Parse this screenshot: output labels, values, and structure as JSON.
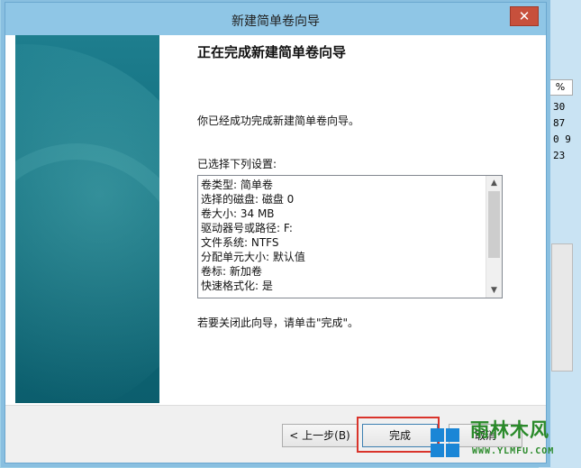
{
  "background_window": {
    "column_header": "%",
    "cells": [
      "30",
      "87",
      "0 9",
      "23"
    ]
  },
  "dialog": {
    "title": "新建简单卷向导",
    "close_glyph": "✕",
    "heading": "正在完成新建简单卷向导",
    "intro": "你已经成功完成新建简单卷向导。",
    "settings_label": "已选择下列设置:",
    "settings": [
      "卷类型: 简单卷",
      "选择的磁盘: 磁盘 0",
      "卷大小: 34 MB",
      "驱动器号或路径: F:",
      "文件系统: NTFS",
      "分配单元大小: 默认值",
      "卷标: 新加卷",
      "快速格式化: 是"
    ],
    "outro": "若要关闭此向导，请单击\"完成\"。",
    "buttons": {
      "back": "< 上一步(B)",
      "finish": "完成",
      "cancel": "取消"
    }
  },
  "watermark": {
    "text": "雨林木风",
    "url": "WWW.YLMFU.COM"
  },
  "colors": {
    "accent": "#8fc6e6",
    "sidebar": "#0f6b7b",
    "highlight": "#d9342b"
  }
}
